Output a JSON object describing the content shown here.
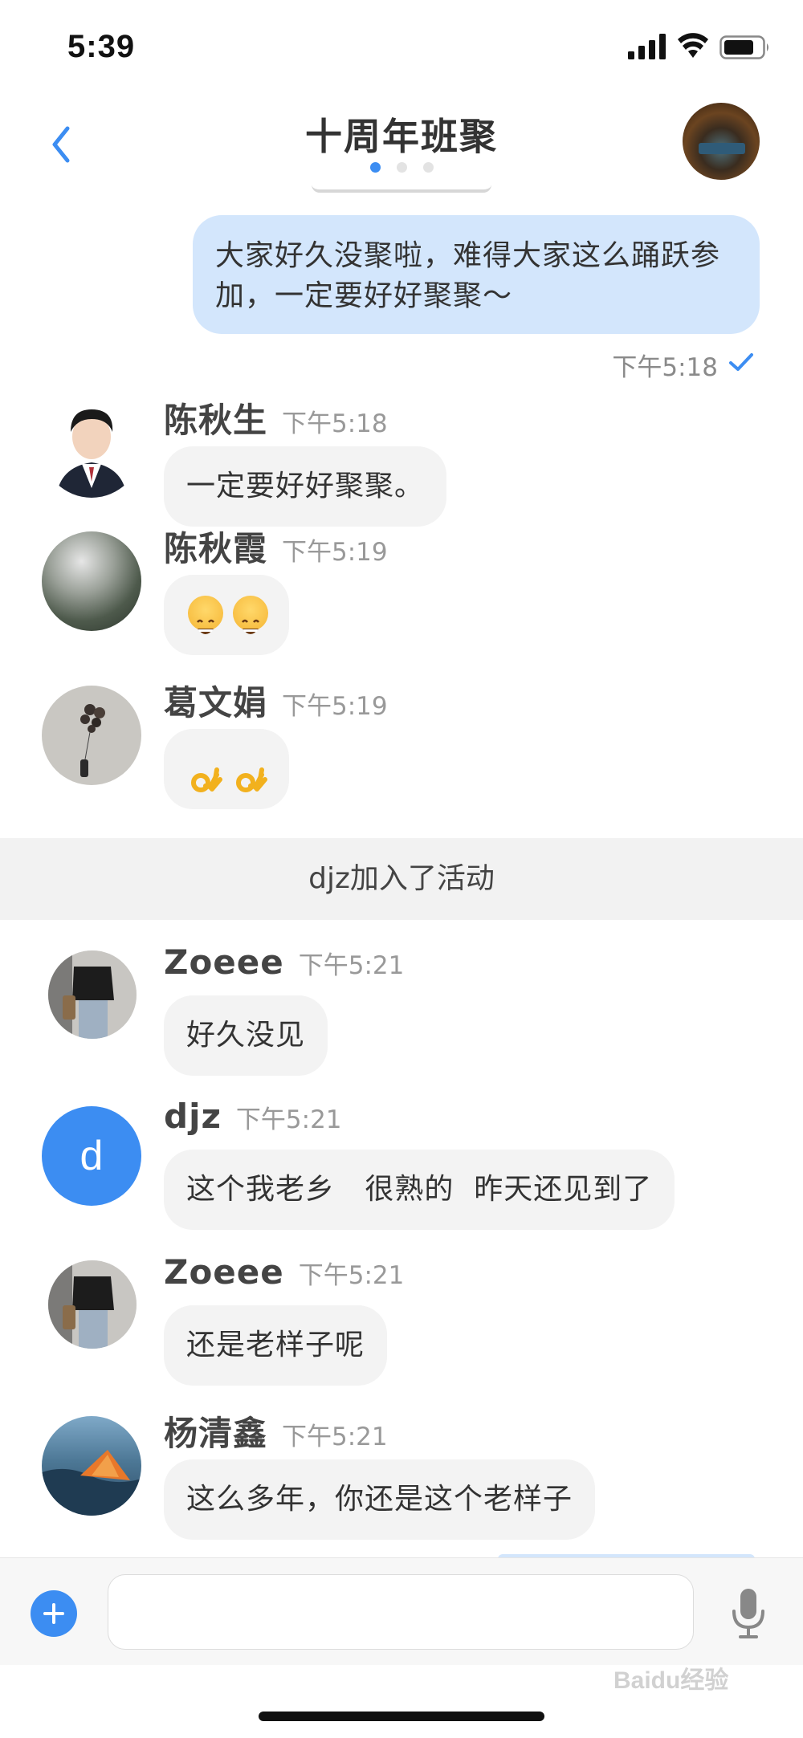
{
  "status_bar": {
    "time": "5:39"
  },
  "header": {
    "title": "十周年班聚",
    "dots": 3,
    "active_dot": 0
  },
  "my_message": {
    "text": "大家好久没聚啦，难得大家这么踊跃参加，一定要好好聚聚～",
    "time": "下午5:18",
    "status_icon": "check-icon"
  },
  "messages": [
    {
      "sender": "陈秋生",
      "time": "下午5:18",
      "text": "一定要好好聚聚。"
    },
    {
      "sender": "陈秋霞",
      "time": "下午5:19",
      "text": "😄😄"
    },
    {
      "sender": "葛文娟",
      "time": "下午5:19",
      "text": "👌👌"
    },
    {
      "sender": "Zoeee",
      "time": "下午5:21",
      "text": "好久没见"
    },
    {
      "sender": "djz",
      "avatar_letter": "d",
      "time": "下午5:21",
      "text": "这个我老乡   很熟的  昨天还见到了"
    },
    {
      "sender": "Zoeee",
      "time": "下午5:21",
      "text": "还是老样子呢"
    },
    {
      "sender": "杨清鑫",
      "time": "下午5:21",
      "text": "这么多年，你还是这个老样子"
    }
  ],
  "system_notice": "djz加入了活动",
  "input": {
    "placeholder": ""
  },
  "watermark": "Baidu经验",
  "colors": {
    "accent": "#3c8df2",
    "my_bubble": "#d3e6fc",
    "other_bubble": "#f3f3f3",
    "system_bar": "#f2f2f2"
  }
}
